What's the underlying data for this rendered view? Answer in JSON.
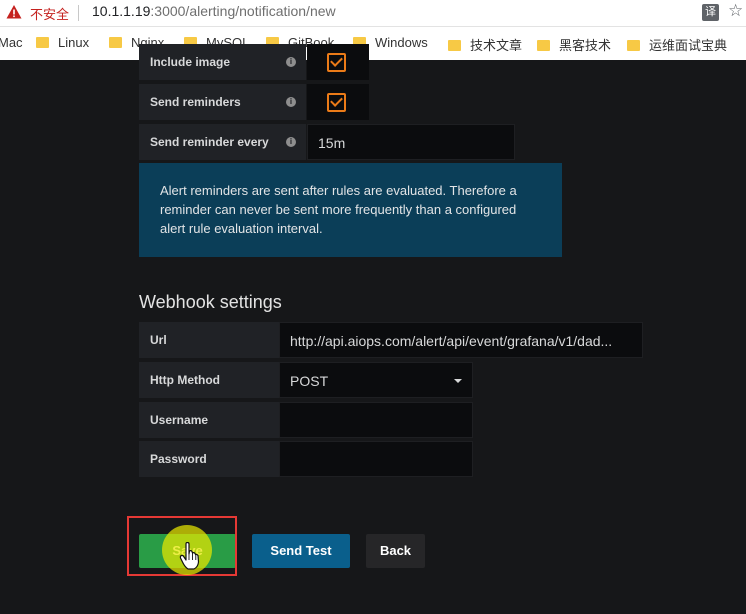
{
  "browser": {
    "insecure_label": "不安全",
    "url_host": "10.1.1.19",
    "url_path": ":3000/alerting/notification/new",
    "translate_icon_text": "译",
    "bookmarks": [
      "Mac",
      "Linux",
      "Nginx",
      "MySQL",
      "GitBook",
      "Windows",
      "技术文章",
      "黑客技术",
      "运维面试宝典"
    ]
  },
  "notification_settings": {
    "include_image_label": "Include image",
    "send_reminders_label": "Send reminders",
    "send_reminder_every_label": "Send reminder every",
    "send_reminder_every_value": "15m",
    "include_image_checked": true,
    "send_reminders_checked": true,
    "info_text": "Alert reminders are sent after rules are evaluated. Therefore a reminder can never be sent more frequently than a configured alert rule evaluation interval."
  },
  "webhook": {
    "title": "Webhook settings",
    "url_label": "Url",
    "url_value": "http://api.aiops.com/alert/api/event/grafana/v1/dad...",
    "method_label": "Http Method",
    "method_value": "POST",
    "username_label": "Username",
    "username_value": "",
    "password_label": "Password",
    "password_value": ""
  },
  "actions": {
    "save_label": "Save",
    "send_test_label": "Send Test",
    "back_label": "Back"
  },
  "colors": {
    "background": "#161719",
    "label_bg": "#202226",
    "input_bg": "#0b0c0e",
    "checkbox_accent": "#eb7b18",
    "info_bg": "#0b3e58",
    "save_green": "#299c46",
    "test_blue": "#0a5f8c",
    "back_gray": "#262628",
    "highlight_red": "#e53935",
    "cursor_halo": "#e8e800"
  },
  "icons": {
    "warning": "warning-triangle-icon",
    "info": "info-circle-icon",
    "folder": "folder-icon",
    "cursor": "hand-pointer-cursor-icon"
  }
}
